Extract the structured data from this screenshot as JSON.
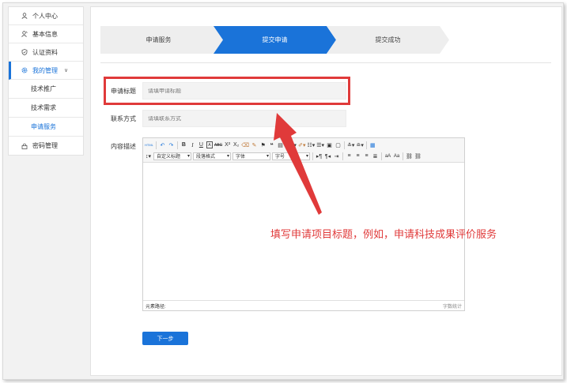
{
  "sidebar": {
    "items": [
      {
        "label": "个人中心",
        "icon": "user-icon"
      },
      {
        "label": "基本信息",
        "icon": "user-edit-icon"
      },
      {
        "label": "认证资料",
        "icon": "shield-icon"
      },
      {
        "label": "我的管理",
        "icon": "settings-icon"
      }
    ],
    "sub_items": [
      "技术推广",
      "技术需求",
      "申请服务"
    ],
    "password_item": {
      "label": "密码管理",
      "icon": "lock-icon"
    }
  },
  "steps": [
    {
      "label": "申请服务",
      "state": "done"
    },
    {
      "label": "提交申请",
      "state": "active"
    },
    {
      "label": "提交成功",
      "state": "pending"
    }
  ],
  "form": {
    "title_label": "申请标题",
    "title_placeholder": "请填申请标题",
    "contact_label": "联系方式",
    "contact_placeholder": "请填联系方式",
    "desc_label": "内容描述"
  },
  "editor": {
    "selects": [
      "自定义标题",
      "段落格式",
      "字体",
      "字号"
    ],
    "status_path": "元素路径:",
    "word_count": "字数统计"
  },
  "next_button": "下一步",
  "annotation": "填写申请项目标题，例如，申请科技成果评价服务",
  "colors": {
    "accent": "#1a73d9",
    "annotation": "#e03a3a",
    "step_inactive": "#eeeeee"
  }
}
